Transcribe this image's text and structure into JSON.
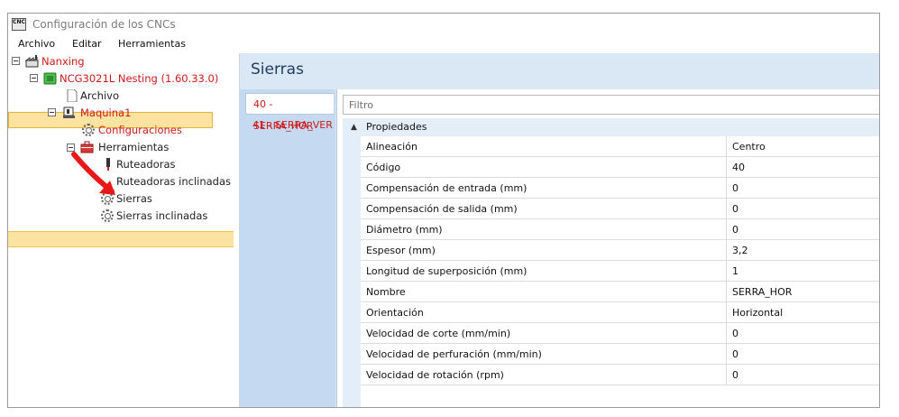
{
  "window": {
    "title": "Configuración de los CNCs",
    "app_icon_text": "CNC"
  },
  "menu": [
    "Archivo",
    "Editar",
    "Herramientas"
  ],
  "tree": {
    "root": "Nanxing",
    "machine": "NCG3021L Nesting (1.60.33.0)",
    "archivo": "Archivo",
    "maquina": "Maquina1",
    "configuraciones": "Configuraciones",
    "herramientas": "Herramientas",
    "ruteadoras": "Ruteadoras",
    "ruteadoras_inclinadas": "Ruteadoras inclinadas",
    "sierras": "Sierras",
    "sierras_inclinadas": "Sierras inclinadas",
    "selected": "Sierras"
  },
  "panel": {
    "title": "Sierras",
    "tabs": [
      "40 - SERRA_HOR",
      "41 - SERRA_VER"
    ],
    "active_tab": "40 - SERRA_HOR",
    "filter_placeholder": "Filtro",
    "category": "Propiedades",
    "category_toggle": "▲",
    "properties": [
      {
        "name": "Alineación",
        "value": "Centro"
      },
      {
        "name": "Código",
        "value": "40"
      },
      {
        "name": "Compensación de entrada (mm)",
        "value": "0"
      },
      {
        "name": "Compensación de salida (mm)",
        "value": "0"
      },
      {
        "name": "Diámetro (mm)",
        "value": "0"
      },
      {
        "name": "Espesor (mm)",
        "value": "3,2"
      },
      {
        "name": "Longitud de superposición (mm)",
        "value": "1"
      },
      {
        "name": "Nombre",
        "value": "SERRA_HOR"
      },
      {
        "name": "Orientación",
        "value": "Horizontal"
      },
      {
        "name": "Velocidad de corte (mm/min)",
        "value": "0"
      },
      {
        "name": "Velocidad de perfuración (mm/min)",
        "value": "0"
      },
      {
        "name": "Velocidad de rotación (rpm)",
        "value": "0"
      }
    ]
  },
  "colors": {
    "selection": "#fde3a1",
    "tree_red_text": "#d01818",
    "panel_bg": "#dae7f5",
    "annotation_arrow": "#e81818"
  }
}
